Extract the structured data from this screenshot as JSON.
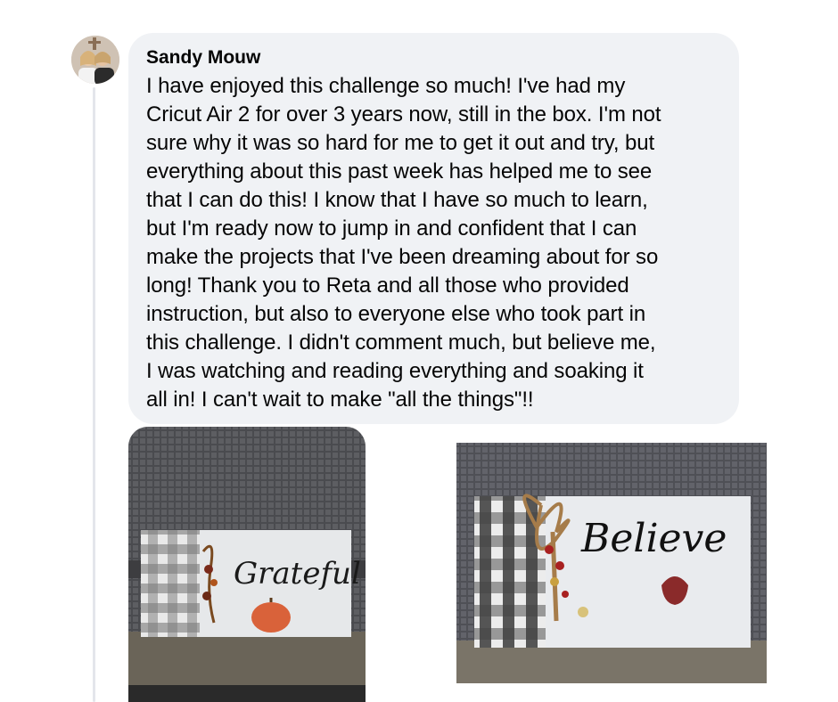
{
  "comment": {
    "author": "Sandy Mouw",
    "lines": [
      "I have enjoyed this challenge so much! I've had my",
      "Cricut Air 2 for over 3 years now, still in the box. I'm not",
      "sure why it was so hard for me to get it out and try, but",
      "everything about this past week has helped me to see",
      "that I can do this! I know that I have so much to learn,",
      "but I'm ready now to jump in and confident that I can",
      "make the projects that I've been dreaming about for so",
      "long! Thank you to Reta and all those who provided",
      "instruction, but also to everyone else who took part in",
      "this challenge. I didn't comment much, but believe me,",
      "I was watching and reading everything and soaking it",
      "all in! I can't wait to make \"all the things\"!!"
    ]
  },
  "attachments": [
    {
      "sign_text": "Grateful"
    },
    {
      "sign_text": "Believe"
    }
  ],
  "colors": {
    "bubble": "#f0f2f5",
    "text": "#050505",
    "thread_line": "#e4e6eb"
  }
}
